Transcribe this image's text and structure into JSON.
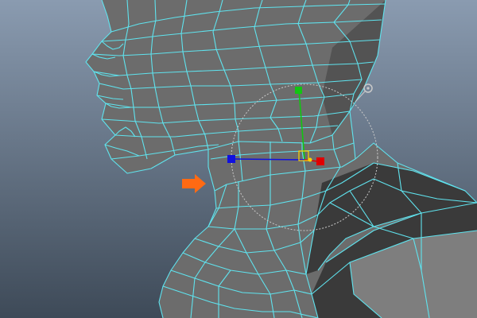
{
  "viewport": {
    "background_top": "#8a9bb0",
    "background_bottom": "#3e4a58"
  },
  "colors": {
    "mesh_fill": "#6c6c6c",
    "mesh_fill_dark": "#3a3a3a",
    "mesh_fill_light": "#7e7e7e",
    "wire": "#5fe3ee",
    "manipulator_ring": "#c9c9c9",
    "axis_x": "#e00000",
    "axis_y": "#12c512",
    "axis_z": "#1010e0",
    "pivot": "#ffd400",
    "annotation_arrow": "#ff6a13"
  },
  "scene": {
    "object": "head-neck-polygon-mesh",
    "selection": "neck-edge-loop",
    "manipulator": "move-tool",
    "annotation": "orange-arrow-pointing-to-selected-loop"
  },
  "icons": {
    "move_manipulator": "move-manipulator-icon",
    "rotation_handle": "rotate-handle-icon",
    "annotation_arrow": "arrow-right-icon"
  }
}
